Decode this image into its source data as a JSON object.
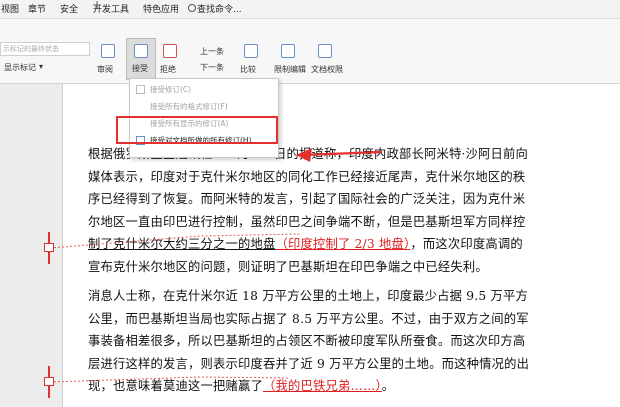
{
  "menu_tabs": [
    "视图",
    "章节",
    "安全",
    "开发工具",
    "特色应用",
    "查找命令..."
  ],
  "ribbon": {
    "markup_display_placeholder": "示标记的最终状态",
    "show_markup": "显示标记",
    "review": "审阅",
    "accept": "接受",
    "reject": "拒绝",
    "previous": "上一条",
    "next": "下一条",
    "compare": "比较",
    "restrict_editing": "限制编辑",
    "document_permissions": "文档权限"
  },
  "accept_menu": {
    "items": [
      "接受修订(C)",
      "接受所有的格式修订(F)",
      "接受所有显示的修订(A)",
      "接受对文档所做的所有修订(H)"
    ]
  },
  "document": {
    "p1_lines": [
      [
        "根据俄罗斯卫星通讯社 12 月 13 日的报道称，印度内政部长阿米特·沙阿日前向",
        ""
      ],
      [
        "媒体表示，印度对于克什米尔地区的同化工作已经接近尾声，克什米尔地区的秩",
        ""
      ],
      [
        "序已经得到了恢复。而阿米特的发言，引起了国际社会的广泛关注，因为克什米",
        ""
      ],
      [
        "尔地区一直由印巴进行控制，虽然印巴之间争端不断，但是巴基斯坦军方同样控",
        ""
      ]
    ],
    "p1_line5_a": "制了克什米尔大约三分之一的地盘",
    "p1_line5_ins": "（印度控制了 2/3 地盘）",
    "p1_line5_b": "，而这次印度高调的",
    "p1_line6": "宣布克什米尔地区的问题，则证明了巴基斯坦在印巴争端之中已经失利。",
    "p2_lines": [
      "消息人士称，在克什米尔近 18 万平方公里的土地上，印度最少占据 9.5 万平方",
      "公里，而巴基斯坦当局也实际占据了 8.5 万平方公里。不过，由于双方之间的军",
      "事装备相差很多，所以巴基斯坦的占领区不断被印度军队所蚕食。而这次印方高",
      "层进行这样的发言，则表示印度吞并了近 9 万平方公里的土地。而这种情况的出"
    ],
    "p2_line5_a": "现，也意味着莫迪这一把赌赢了",
    "p2_line5_ins": "（我的巴铁兄弟……）",
    "p2_line5_b": "。"
  },
  "colors": {
    "revision_red": "#e02020",
    "highlight_box": "#e53030"
  }
}
